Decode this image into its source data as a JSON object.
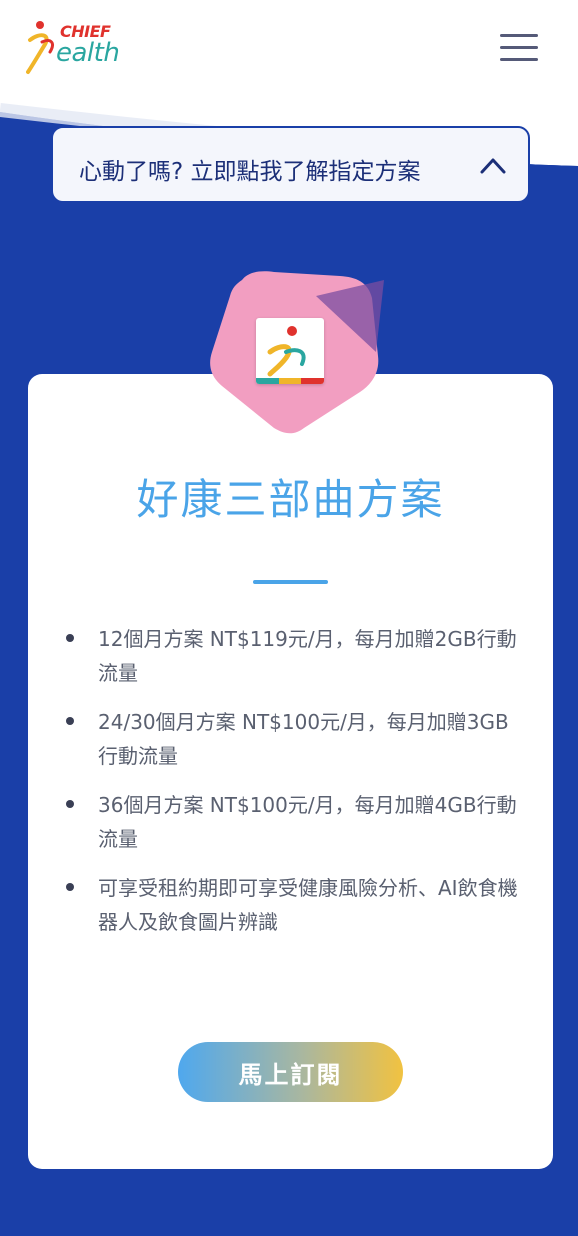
{
  "header": {
    "logo_chief": "CHIEF",
    "logo_health": "ealth",
    "menu_icon": "hamburger-menu-icon"
  },
  "banner": {
    "text": "心動了嗎? 立即點我了解指定方案",
    "chevron_icon": "chevron-up-icon"
  },
  "plan": {
    "badge_icon": "chief-health-app-icon",
    "title": "好康三部曲方案",
    "features": [
      "12個月方案 NT$119元/月，每月加贈2GB行動流量",
      "24/30個月方案 NT$100元/月，每月加贈3GB行動流量",
      "36個月方案 NT$100元/月，每月加贈4GB行動流量",
      "可享受租約期即可享受健康風險分析、AI飲食機器人及飲食圖片辨識"
    ],
    "cta_label": "馬上訂閱"
  },
  "colors": {
    "background_blue": "#1a3fa8",
    "title_blue": "#4aa4e8",
    "badge_pink": "#f29ec1",
    "cta_gradient_start": "#4fa8ee",
    "cta_gradient_end": "#f1c241"
  }
}
